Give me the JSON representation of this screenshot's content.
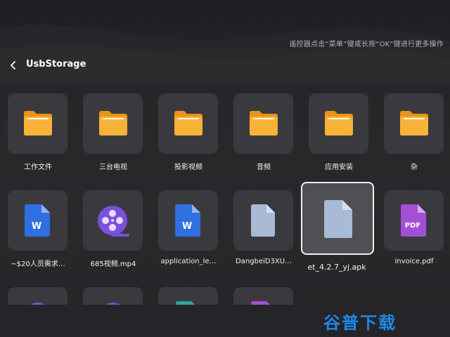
{
  "header": {
    "hint": "遥控器点击“菜单”键或长按“OK”键进行更多操作",
    "title": "UsbStorage"
  },
  "folders": [
    {
      "label": "工作文件",
      "icon": "folder-icon"
    },
    {
      "label": "三台电视",
      "icon": "folder-icon"
    },
    {
      "label": "投影视频",
      "icon": "folder-icon"
    },
    {
      "label": "音频",
      "icon": "folder-icon"
    },
    {
      "label": "应用安装",
      "icon": "folder-icon"
    },
    {
      "label": "杂",
      "icon": "folder-icon"
    }
  ],
  "files": [
    {
      "label": "~$20人员需求…",
      "icon": "word-doc-icon",
      "badge": "W"
    },
    {
      "label": "685视频.mp4",
      "icon": "video-file-icon"
    },
    {
      "label": "application_le…",
      "icon": "word-doc-icon",
      "badge": "W"
    },
    {
      "label": "DangbeiD3XU…",
      "icon": "generic-file-icon"
    },
    {
      "label": "et_4.2.7_yj.apk",
      "icon": "generic-file-icon"
    },
    {
      "label": "invoice.pdf",
      "icon": "pdf-file-icon",
      "badge": "PDF"
    }
  ],
  "watermark": "谷普下载",
  "colors": {
    "folder": "#f5a623",
    "word": "#2f6fe0",
    "video": "#7b4fe0",
    "pdf": "#a34fd6",
    "generic": "#a9bad6",
    "tile": "#3a3a3e",
    "focus_border": "#f0f0f0"
  }
}
